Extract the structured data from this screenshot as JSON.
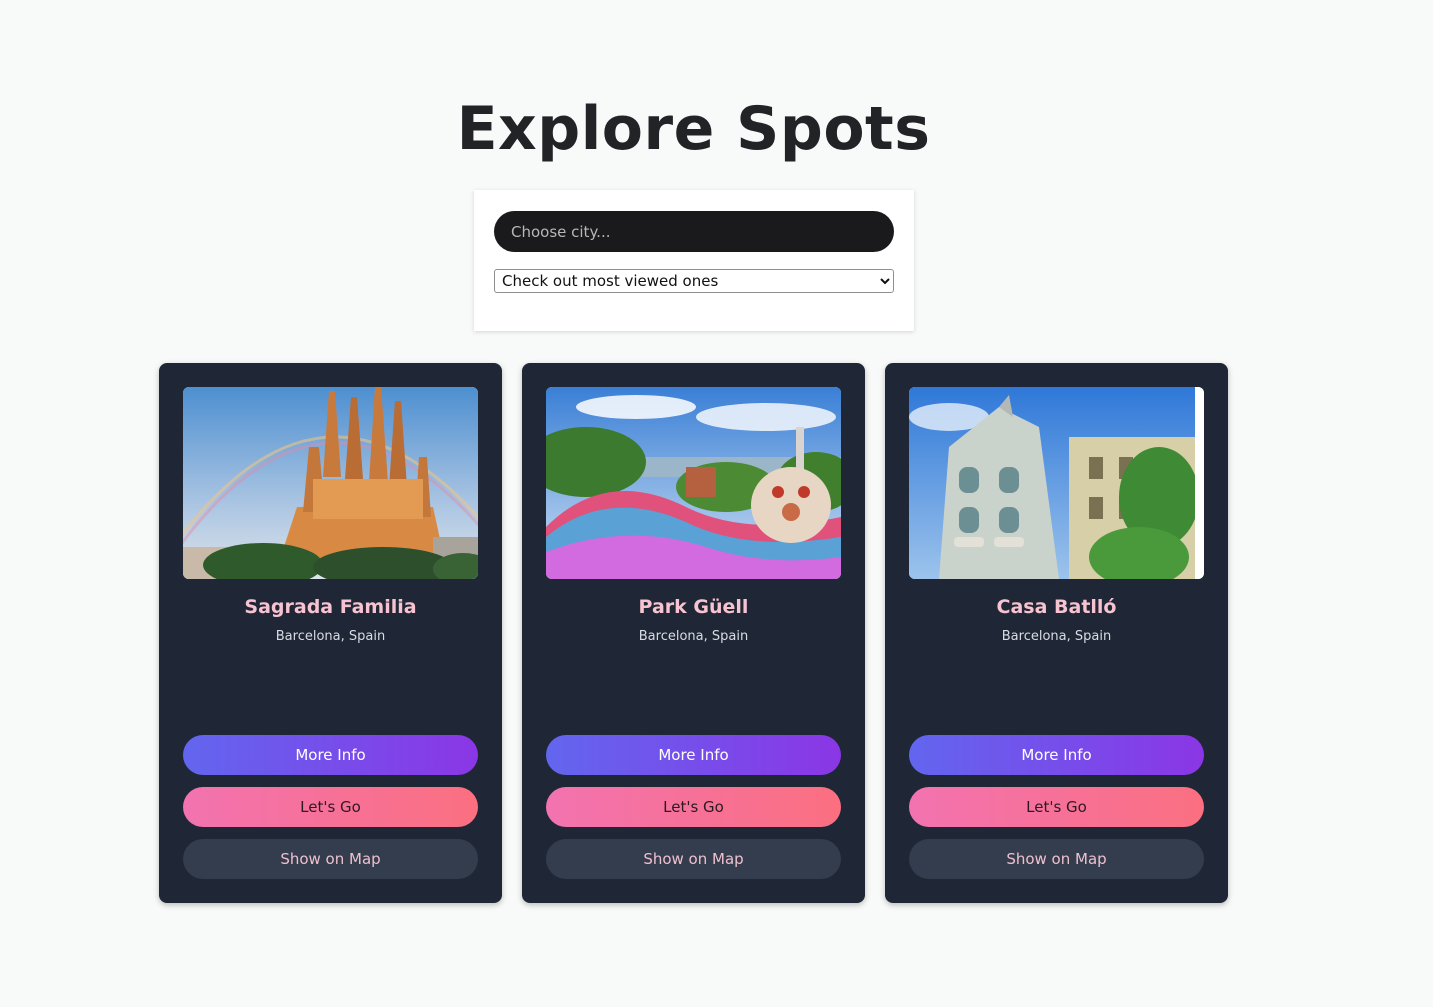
{
  "header": {
    "title": "Explore Spots"
  },
  "search": {
    "placeholder": "Choose city...",
    "sort_selected": "Check out most viewed ones"
  },
  "cards": [
    {
      "title": "Sagrada Familia",
      "location": "Barcelona, Spain",
      "image_icon": "cathedral-photo",
      "more_info": "More Info",
      "lets_go": "Let's Go",
      "show_on_map": "Show on Map"
    },
    {
      "title": "Park Güell",
      "location": "Barcelona, Spain",
      "image_icon": "mosaic-park-photo",
      "more_info": "More Info",
      "lets_go": "Let's Go",
      "show_on_map": "Show on Map"
    },
    {
      "title": "Casa Batlló",
      "location": "Barcelona, Spain",
      "image_icon": "building-facade-photo",
      "more_info": "More Info",
      "lets_go": "Let's Go",
      "show_on_map": "Show on Map"
    }
  ],
  "colors": {
    "page_bg": "#f8f9f9",
    "card_bg": "#1f2736",
    "title_pink": "#f7c3d0",
    "info_gradient": [
      "#6266ef",
      "#8b36e6"
    ],
    "go_gradient": [
      "#f273b0",
      "#fb6f80"
    ],
    "map_button": "#343d4d"
  }
}
